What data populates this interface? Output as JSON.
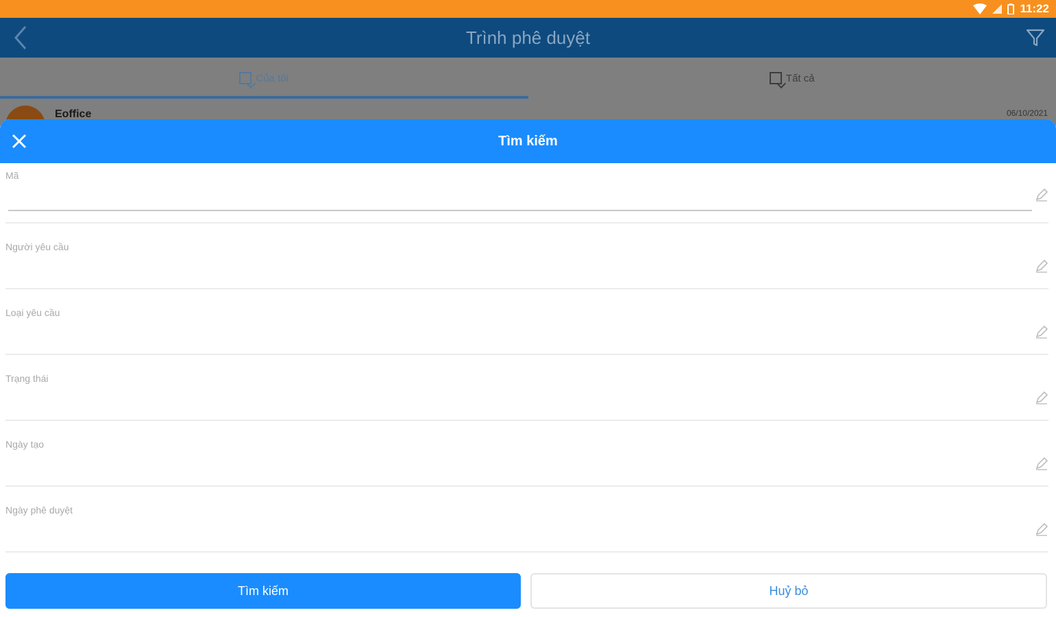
{
  "status_bar": {
    "time": "11:22"
  },
  "app_bar": {
    "title": "Trình phê duyệt"
  },
  "tabs": [
    {
      "label": "Của tôi",
      "active": true
    },
    {
      "label": "Tất cả",
      "active": false
    }
  ],
  "list": {
    "first_item": {
      "name": "Eoffice",
      "date": "06/10/2021"
    }
  },
  "sheet": {
    "title": "Tìm kiếm",
    "fields": [
      {
        "label": "Mã",
        "value": "",
        "focused": true
      },
      {
        "label": "Người yêu cầu",
        "value": ""
      },
      {
        "label": "Loại yêu cầu",
        "value": ""
      },
      {
        "label": "Trạng thái",
        "value": ""
      },
      {
        "label": "Ngày tạo",
        "value": ""
      },
      {
        "label": "Ngày phê duyệt",
        "value": ""
      }
    ],
    "search_button": "Tìm kiếm",
    "cancel_button": "Huỷ bỏ"
  },
  "colors": {
    "status_bar": "#f7901e",
    "app_bar": "#0e4a7e",
    "sheet_header": "#1a8cff",
    "primary_button": "#1a8cff",
    "cancel_text": "#3a8de0"
  }
}
